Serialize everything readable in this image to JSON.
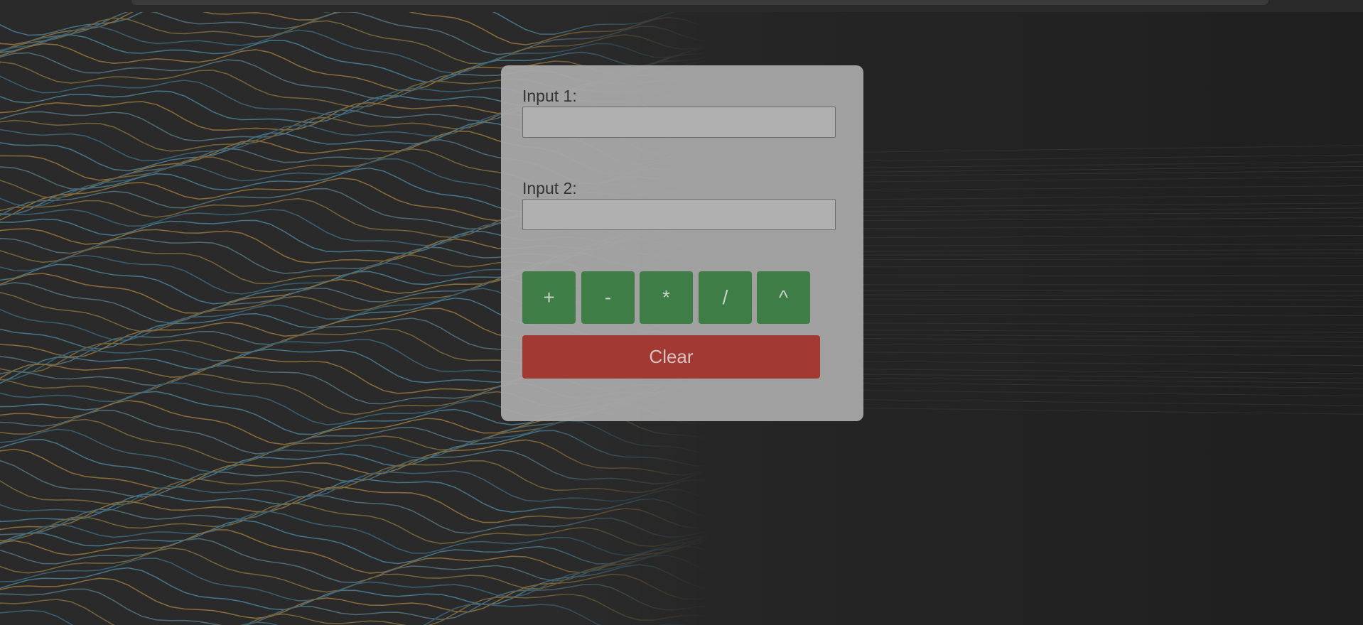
{
  "form": {
    "input1": {
      "label": "Input 1:",
      "value": "",
      "placeholder": ""
    },
    "input2": {
      "label": "Input 2:",
      "value": "",
      "placeholder": ""
    }
  },
  "operators": {
    "add": "+",
    "subtract": "-",
    "multiply": "*",
    "divide": "/",
    "power": "^"
  },
  "clear_label": "Clear",
  "colors": {
    "panel": "#aaaaaa",
    "operator_button": "#3f7d46",
    "clear_button": "#a23a33",
    "background": "#232323"
  }
}
